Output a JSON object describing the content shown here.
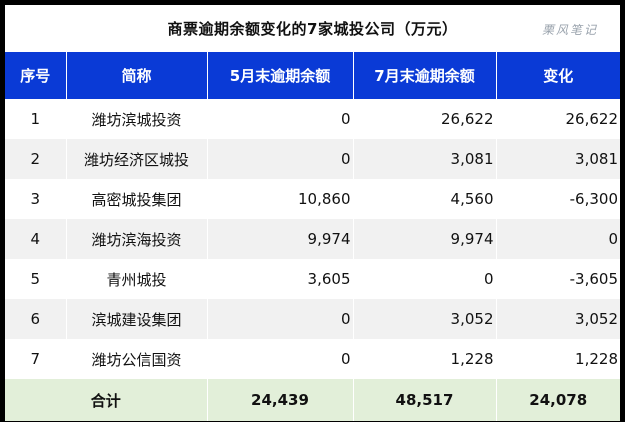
{
  "title": "商票逾期余额变化的7家城投公司（万元）",
  "watermark": "栗风笔记",
  "headers": [
    "序号",
    "简称",
    "5月末逾期余额",
    "7月末逾期余额",
    "变化"
  ],
  "rows": [
    [
      "1",
      "潍坊滨城投资",
      "0",
      "26,622",
      "26,622"
    ],
    [
      "2",
      "潍坊经济区城投",
      "0",
      "3,081",
      "3,081"
    ],
    [
      "3",
      "高密城投集团",
      "10,860",
      "4,560",
      "-6,300"
    ],
    [
      "4",
      "潍坊滨海投资",
      "9,974",
      "9,974",
      "0"
    ],
    [
      "5",
      "青州城投",
      "3,605",
      "0",
      "-3,605"
    ],
    [
      "6",
      "滨城建设集团",
      "0",
      "3,052",
      "3,052"
    ],
    [
      "7",
      "潍坊公信国资",
      "0",
      "1,228",
      "1,228"
    ]
  ],
  "total": {
    "label": "合计",
    "may": "24,439",
    "jul": "48,517",
    "change": "24,078"
  }
}
